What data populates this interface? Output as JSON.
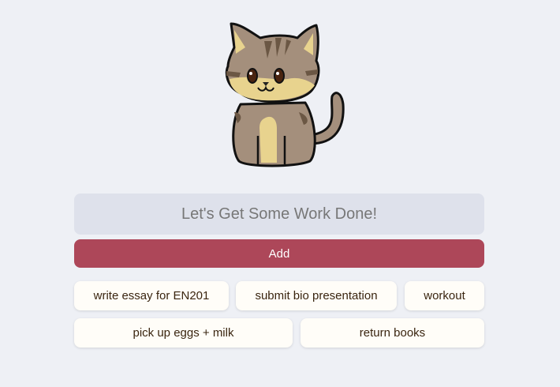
{
  "input": {
    "placeholder": "Let's Get Some Work Done!",
    "value": ""
  },
  "add_button": {
    "label": "Add"
  },
  "todos": [
    {
      "label": "write essay for EN201"
    },
    {
      "label": "submit bio presentation"
    },
    {
      "label": "workout"
    },
    {
      "label": "pick up eggs + milk"
    },
    {
      "label": "return books"
    }
  ],
  "colors": {
    "accent": "#ad4759",
    "background": "#eef0f5",
    "input_bg": "#dee1eb",
    "todo_bg": "#fffdf8"
  }
}
